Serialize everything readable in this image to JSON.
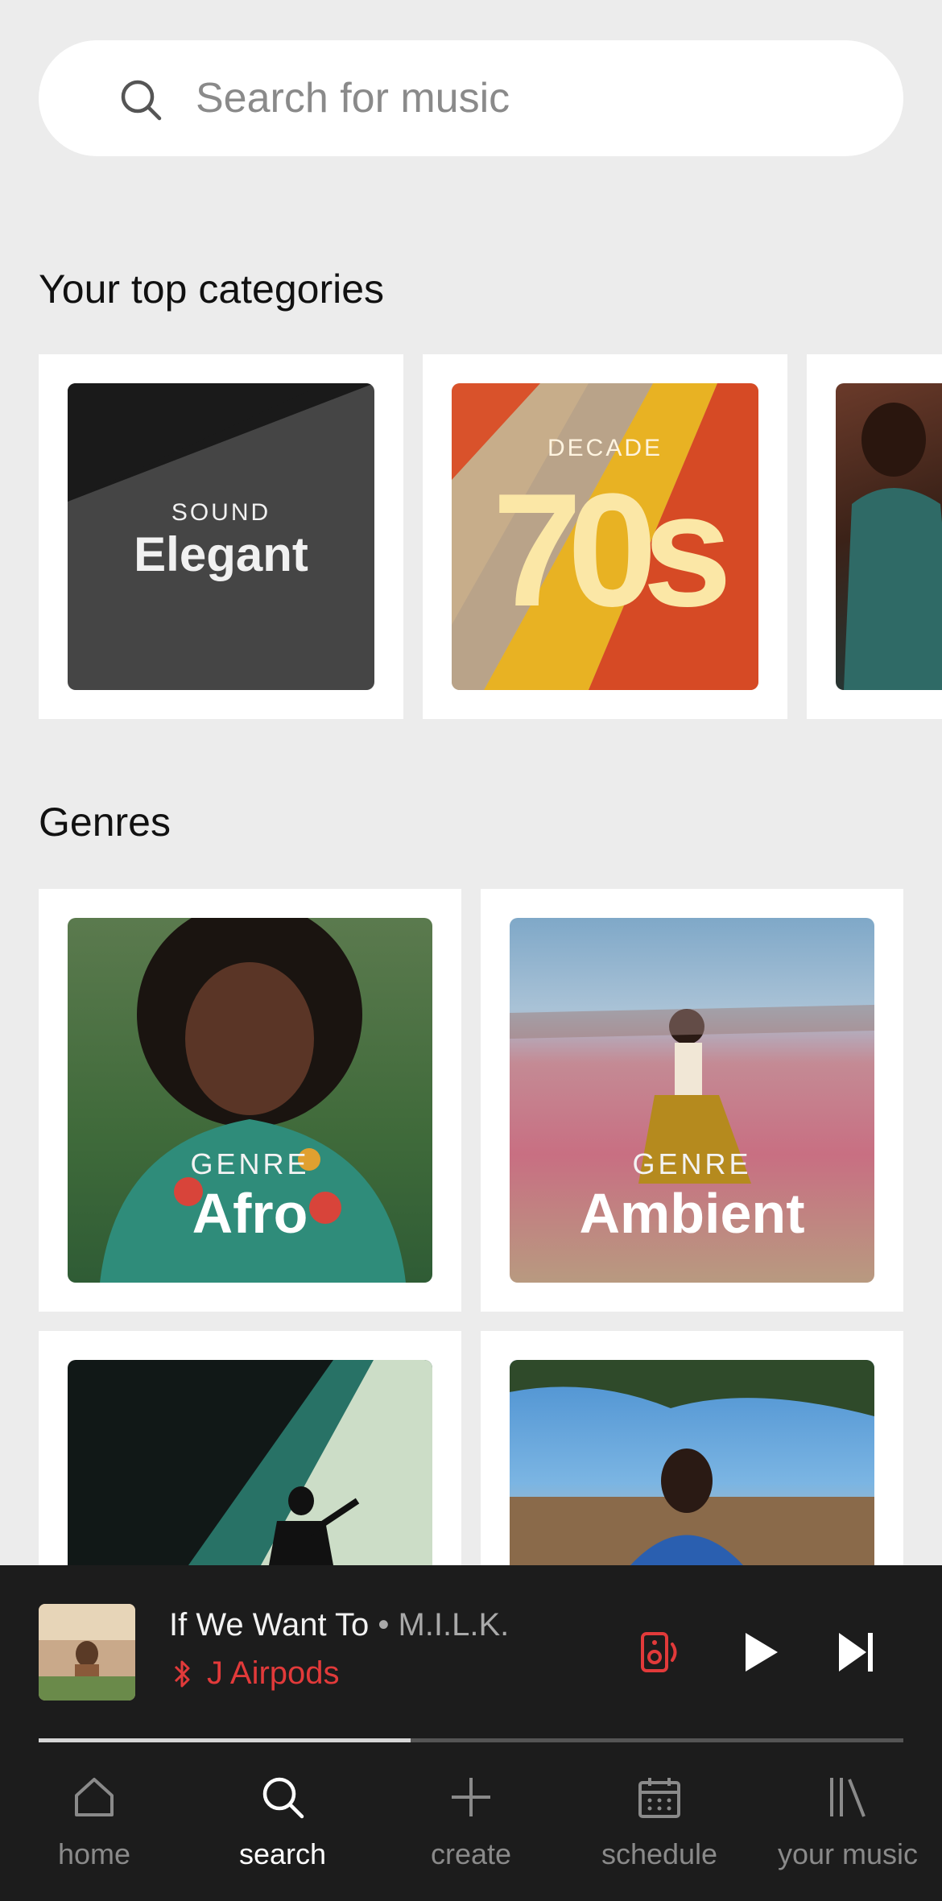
{
  "search": {
    "placeholder": "Search for music"
  },
  "top_categories": {
    "title": "Your top categories",
    "items": [
      {
        "kicker": "SOUND",
        "label": "Elegant"
      },
      {
        "kicker": "DECADE",
        "label": "70s"
      }
    ]
  },
  "genres": {
    "title": "Genres",
    "items": [
      {
        "kicker": "GENRE",
        "label": "Afro"
      },
      {
        "kicker": "GENRE",
        "label": "Ambient"
      }
    ]
  },
  "now_playing": {
    "track": "If We Want To",
    "separator": " • ",
    "artist": "M.I.L.K.",
    "device": "J Airpods",
    "progress": 0.43
  },
  "nav": {
    "items": [
      {
        "label": "home",
        "icon": "home-icon"
      },
      {
        "label": "search",
        "icon": "search-icon"
      },
      {
        "label": "create",
        "icon": "plus-icon"
      },
      {
        "label": "schedule",
        "icon": "calendar-icon"
      },
      {
        "label": "your music",
        "icon": "library-icon"
      }
    ],
    "active": "search"
  },
  "colors": {
    "background": "#ececec",
    "player_bg": "#1c1c1c",
    "accent_red": "#e23a3a"
  }
}
